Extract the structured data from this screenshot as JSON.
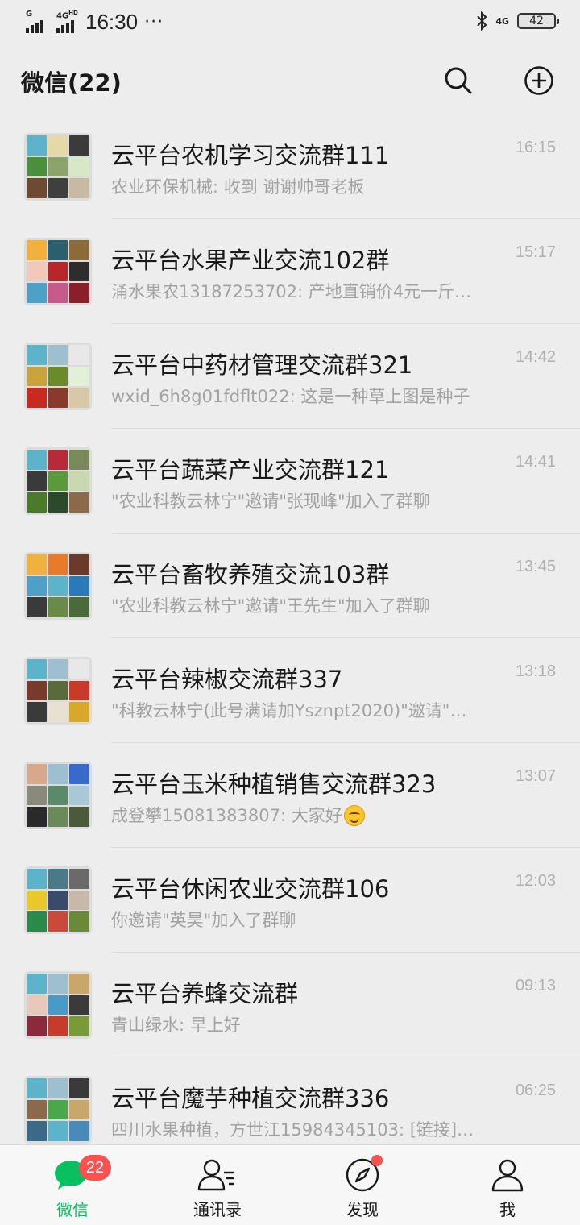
{
  "status_bar": {
    "signal1_label": "G",
    "signal2_label": "4G",
    "signal2_sup": "HD",
    "time": "16:30",
    "dots": "···",
    "network": "4G",
    "battery": "42"
  },
  "header": {
    "title": "微信(22)",
    "search_icon": "search-icon",
    "add_icon": "plus-circle-icon"
  },
  "chats": [
    {
      "name": "云平台农机学习交流群111",
      "preview": "农业环保机械: 收到 谢谢帅哥老板",
      "time": "16:15",
      "colors": [
        "#5bb4c9",
        "#e6d9a8",
        "#3b3b3b",
        "#4a8f3a",
        "#8aa46a",
        "#d7e8c4",
        "#6e4a32",
        "#3f3f3f",
        "#c8b9a5"
      ]
    },
    {
      "name": "云平台水果产业交流102群",
      "preview": "涌水果农13187253702: 产地直销价4元一斤…",
      "time": "15:17",
      "colors": [
        "#f2b03c",
        "#2a5f6e",
        "#8b6b3a",
        "#f1c9b8",
        "#b8262a",
        "#2d2d2d",
        "#4fa0c8",
        "#c75a8a",
        "#8a1e2a"
      ]
    },
    {
      "name": "云平台中药材管理交流群321",
      "preview": "wxid_6h8g01fdflt022: 这是一种草上图是种子",
      "time": "14:42",
      "colors": [
        "#5bb4c9",
        "#9dbfd0",
        "#e8e8e8",
        "#c9a43a",
        "#6b8a2a",
        "#e3f0d8",
        "#c82a1e",
        "#8a3a2a",
        "#d9c8a8"
      ]
    },
    {
      "name": "云平台蔬菜产业交流群121",
      "preview": "\"农业科教云林宁\"邀请\"张现峰\"加入了群聊",
      "time": "14:41",
      "colors": [
        "#5bb4c9",
        "#b82a3a",
        "#7a8a5a",
        "#3a3a3a",
        "#5a9a3a",
        "#c8d8b0",
        "#4a7a2a",
        "#2a4a2a",
        "#8a6a4a"
      ]
    },
    {
      "name": "云平台畜牧养殖交流103群",
      "preview": "\"农业科教云林宁\"邀请\"王先生\"加入了群聊",
      "time": "13:45",
      "colors": [
        "#f2b03c",
        "#e87a2a",
        "#6a3a2a",
        "#4fa0c8",
        "#5bb4c9",
        "#2a7ab8",
        "#3a3a3a",
        "#6a8a4a",
        "#4a6a3a"
      ]
    },
    {
      "name": "云平台辣椒交流群337",
      "preview": "\"科教云林宁(此号满请加Ysznpt2020)\"邀请\"…",
      "time": "13:18",
      "colors": [
        "#5bb4c9",
        "#9dbfd0",
        "#e8e8e8",
        "#7a3a2a",
        "#5a6a3a",
        "#c83a2a",
        "#3a3a3a",
        "#e8e0d0",
        "#d8a82a"
      ]
    },
    {
      "name": "云平台玉米种植销售交流群323",
      "preview": "成登攀15081383807: 大家好",
      "emoji": true,
      "time": "13:07",
      "colors": [
        "#d8a88a",
        "#9dbfd0",
        "#3a6ac8",
        "#8a8a7a",
        "#5a8a6a",
        "#a8c8d8",
        "#2a2a2a",
        "#6a8a5a",
        "#4a5a3a"
      ]
    },
    {
      "name": "云平台休闲农业交流群106",
      "preview": "你邀请\"英昊\"加入了群聊",
      "time": "12:03",
      "colors": [
        "#5bb4c9",
        "#4a7a8a",
        "#6a6a6a",
        "#e8c82a",
        "#3a4a6a",
        "#c8b8a8",
        "#2a8a4a",
        "#c84a3a",
        "#6a8a3a"
      ]
    },
    {
      "name": "云平台养蜂交流群",
      "preview": "青山绿水: 早上好",
      "time": "09:13",
      "colors": [
        "#5bb4c9",
        "#9dbfd0",
        "#c8a86a",
        "#e8c8b8",
        "#4a9ac8",
        "#3a3a3a",
        "#8a2a3a",
        "#c83a2a",
        "#7a9a3a"
      ]
    },
    {
      "name": "云平台魔芋种植交流群336",
      "preview": "四川水果种植，方世江15984345103: [链接]…",
      "time": "06:25",
      "colors": [
        "#5bb4c9",
        "#9dbfd0",
        "#3a3a3a",
        "#8a6a4a",
        "#4aa84a",
        "#c8a86a",
        "#3a6a8a",
        "#5bb4c9",
        "#4a8ab8"
      ]
    }
  ],
  "tabs": [
    {
      "label": "微信",
      "icon": "chat-bubble-icon",
      "badge": "22",
      "active": true
    },
    {
      "label": "通讯录",
      "icon": "contacts-icon"
    },
    {
      "label": "发现",
      "icon": "compass-icon",
      "dot": true
    },
    {
      "label": "我",
      "icon": "person-icon"
    }
  ],
  "colors": {
    "accent": "#07c160",
    "badge": "#fa5151",
    "background": "#ededed"
  }
}
